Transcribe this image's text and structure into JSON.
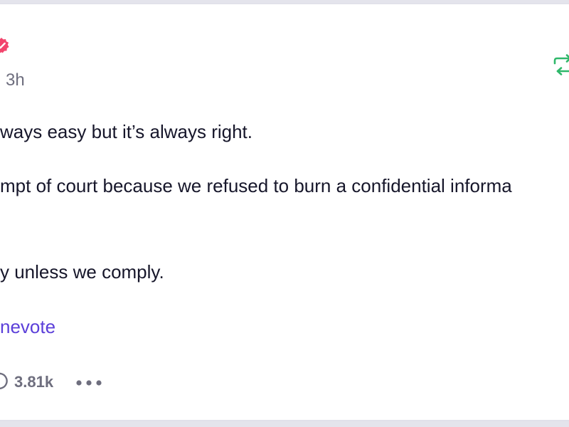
{
  "post": {
    "timestamp": "3h",
    "body_lines": [
      "ways easy but it’s always right.",
      "mpt of court because we refused to burn a confidential informa",
      "y unless we comply."
    ],
    "link_text": "nevote",
    "actions": {
      "comment_count": "3.81k"
    }
  },
  "icons": {
    "badge": "verified-badge-icon",
    "retweet": "retweet-icon",
    "comment": "comment-icon",
    "more": "more-options-icon"
  },
  "colors": {
    "badge": "#f2456d",
    "retweet": "#2fb86a",
    "link": "#5b3fd9",
    "text": "#16162a",
    "muted": "#6e6e7e"
  }
}
